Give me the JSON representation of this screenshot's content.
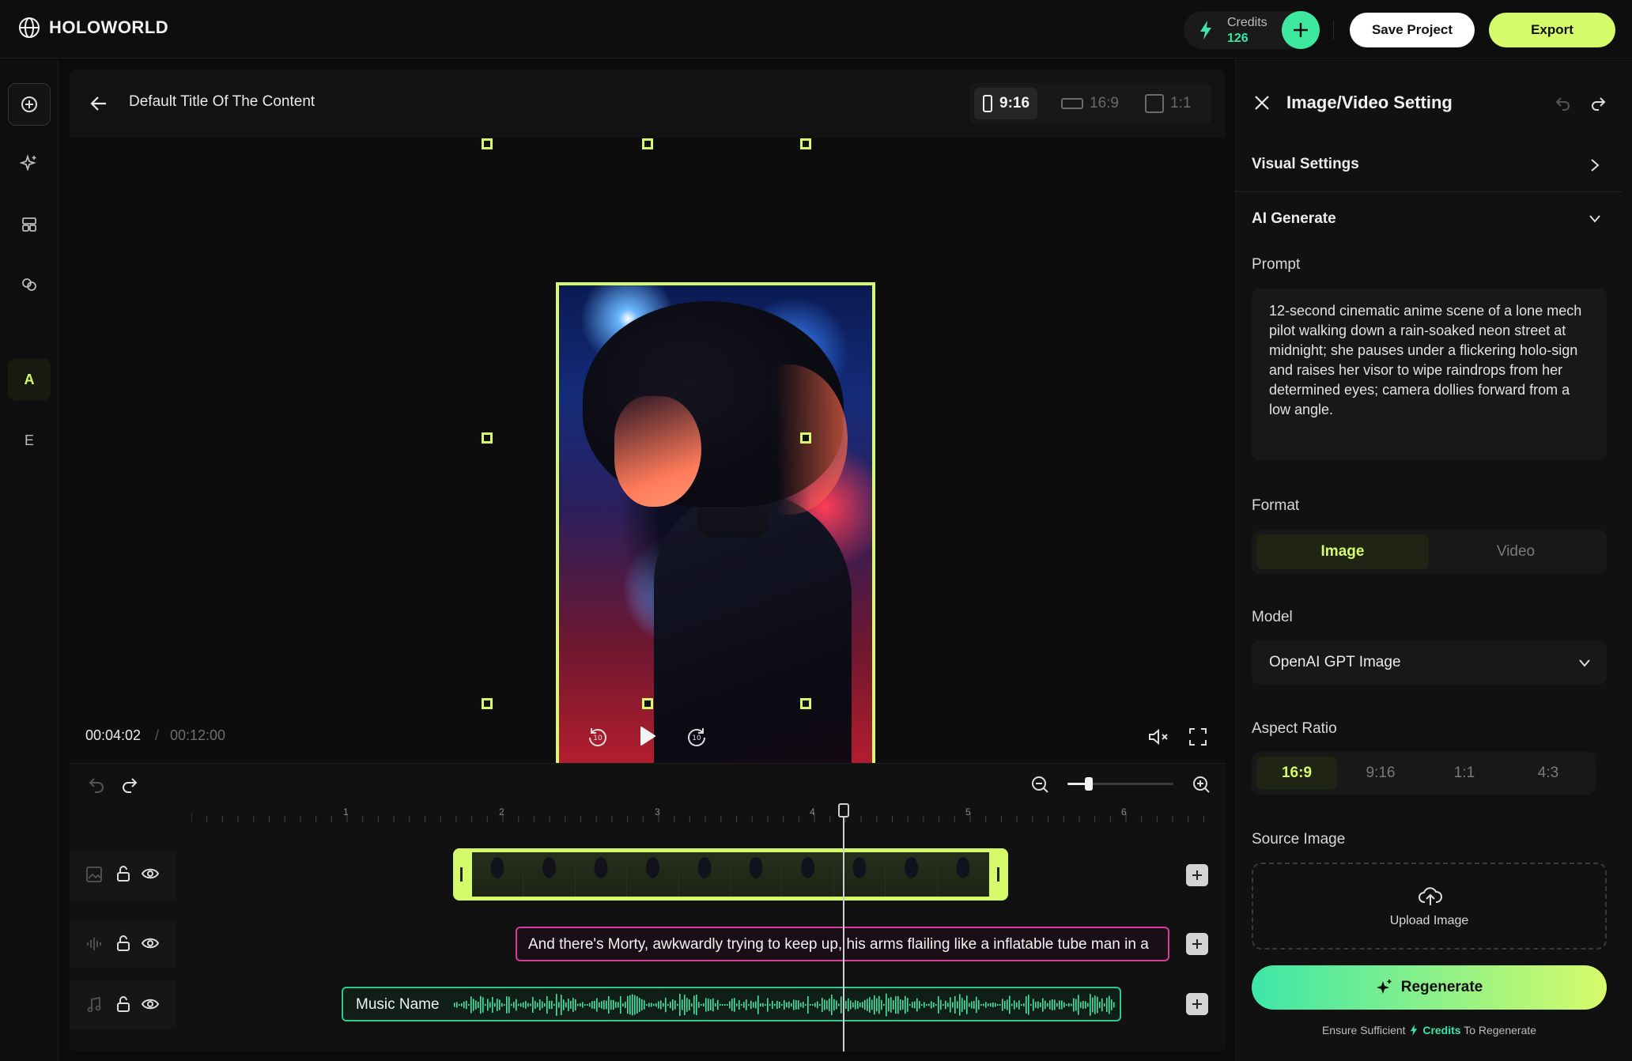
{
  "app": {
    "name": "HOLOWORLD"
  },
  "topbar": {
    "credits_label": "Credits",
    "credits_value": "126",
    "save_label": "Save Project",
    "export_label": "Export"
  },
  "rail": {
    "items": [
      {
        "icon": "add-circle-icon"
      },
      {
        "icon": "sparkle-icon"
      },
      {
        "icon": "layout-icon"
      },
      {
        "icon": "link-icon"
      },
      {
        "label": "A"
      },
      {
        "label": "E"
      }
    ]
  },
  "editor": {
    "title": "Default Title Of The Content",
    "ratios": [
      {
        "label": "9:16",
        "selected": true
      },
      {
        "label": "16:9",
        "selected": false
      },
      {
        "label": "1:1",
        "selected": false
      }
    ],
    "time_current": "00:04:02",
    "time_separator": "/",
    "time_total": "00:12:00",
    "zoom_level": 0.2
  },
  "timeline": {
    "ticks": [
      "1",
      "2",
      "3",
      "4",
      "5",
      "6"
    ],
    "caption_text": "And there's Morty, awkwardly trying to keep up, his arms flailing like a inflatable tube man in a",
    "music_label": "Music Name"
  },
  "panel": {
    "title": "Image/Video Setting",
    "visual_settings": "Visual Settings",
    "ai_generate": "AI Generate",
    "prompt_label": "Prompt",
    "prompt_text": "12-second cinematic anime scene of a lone mech pilot walking down a rain-soaked neon street at midnight; she pauses under a flickering holo-sign and raises her visor to wipe raindrops from her determined eyes; camera dollies forward from a low angle.",
    "format_label": "Format",
    "format_options": [
      "Image",
      "Video"
    ],
    "format_selected": "Image",
    "model_label": "Model",
    "model_value": "OpenAI GPT Image",
    "aspect_label": "Aspect Ratio",
    "aspect_options": [
      "16:9",
      "9:16",
      "1:1",
      "4:3"
    ],
    "aspect_selected": "16:9",
    "source_label": "Source Image",
    "upload_label": "Upload Image",
    "regenerate_label": "Regenerate",
    "note_pre": "Ensure Sufficient",
    "note_credits": "Credits",
    "note_post": "To Regenerate"
  },
  "colors": {
    "accent": "#d6fb6a",
    "green": "#3de6a8",
    "caption": "#d93a9c"
  }
}
